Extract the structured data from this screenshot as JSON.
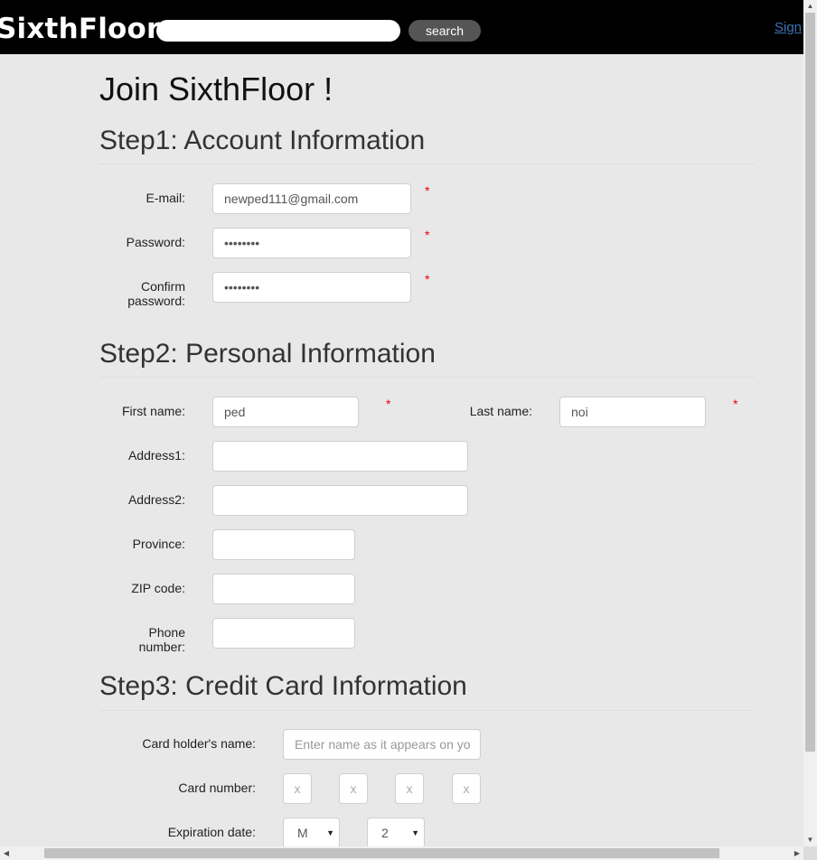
{
  "header": {
    "logo": "SixthFloor",
    "search_value": "",
    "search_button": "search",
    "sign_link": "Sign"
  },
  "page_title": "Join SixthFloor !",
  "step1": {
    "title": "Step1: Account Information",
    "email_label": "E-mail:",
    "email_value": "newped111@gmail.com",
    "password_label": "Password:",
    "password_value": "••••••••",
    "confirm_label_1": "Confirm",
    "confirm_label_2": "password:",
    "confirm_value": "••••••••",
    "required_mark": "*"
  },
  "step2": {
    "title": "Step2: Personal Information",
    "first_name_label": "First name:",
    "first_name_value": "ped",
    "last_name_label": "Last name:",
    "last_name_value": "noi",
    "address1_label": "Address1:",
    "address1_value": "",
    "address2_label": "Address2:",
    "address2_value": "",
    "province_label": "Province:",
    "province_value": "",
    "zip_label": "ZIP code:",
    "zip_value": "",
    "phone_label_1": "Phone",
    "phone_label_2": "number:",
    "phone_value": ""
  },
  "step3": {
    "title": "Step3: Credit Card Information",
    "holder_label": "Card holder's name:",
    "holder_placeholder": "Enter name as it appears on yo",
    "card_number_label": "Card number:",
    "card_number_placeholders": [
      "x",
      "x",
      "x",
      "x"
    ],
    "expiration_label": "Expiration date:",
    "month_value": "M",
    "year_value": "2"
  }
}
